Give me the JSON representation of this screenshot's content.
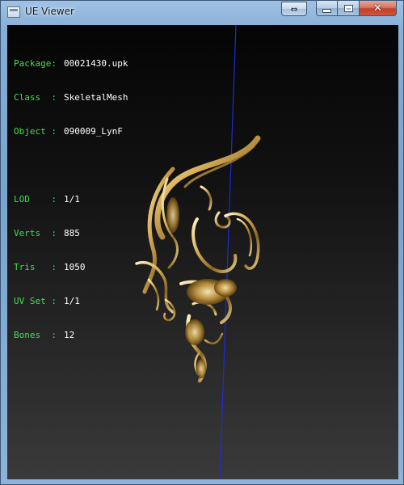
{
  "window": {
    "title": "UE Viewer",
    "buttons": {
      "restore_glyph": "⇔",
      "minimize": "minimize",
      "maximize": "maximize",
      "close_glyph": "✕"
    }
  },
  "info": {
    "package_label": "Package:",
    "package_value": "00021430.upk",
    "class_label": "Class  :",
    "class_value": "SkeletalMesh",
    "object_label": "Object :",
    "object_value": "090009_LynF",
    "lod_label": "LOD    :",
    "lod_value": "1/1",
    "verts_label": "Verts  :",
    "verts_value": "885",
    "tris_label": "Tris   :",
    "tris_value": "1050",
    "uvset_label": "UV Set :",
    "uvset_value": "1/1",
    "bones_label": "Bones  :",
    "bones_value": "12"
  },
  "colors": {
    "label_green": "#3fe04a",
    "value_white": "#ffffff",
    "axis_blue": "#1f2bd8",
    "mesh_gold": "#c9a24a"
  },
  "icons": [
    "app-icon",
    "restore-size-icon",
    "minimize-icon",
    "maximize-icon",
    "close-icon"
  ]
}
